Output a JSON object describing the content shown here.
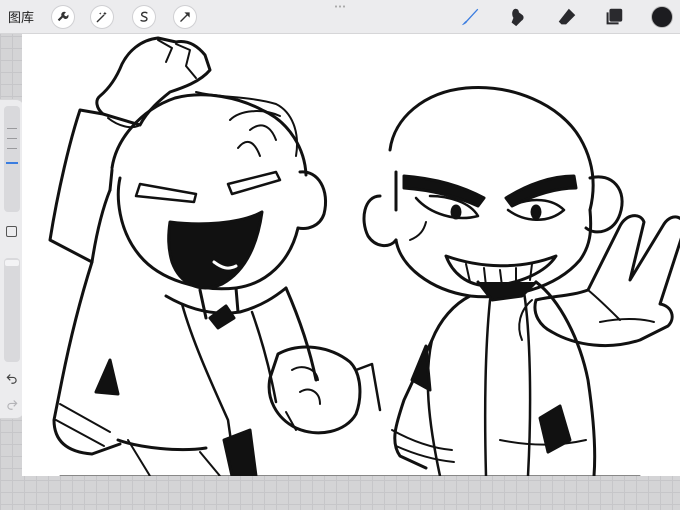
{
  "topbar": {
    "gallery_label": "图库",
    "left_tools": [
      {
        "icon": "wrench-icon"
      },
      {
        "icon": "magic-wand-icon"
      },
      {
        "icon": "selection-s-icon"
      },
      {
        "icon": "transform-arrow-icon"
      }
    ],
    "right_tools": [
      {
        "icon": "brush-icon",
        "active": true
      },
      {
        "icon": "smudge-icon",
        "active": false
      },
      {
        "icon": "eraser-icon",
        "active": false
      },
      {
        "icon": "layers-icon",
        "active": false
      }
    ],
    "active_color": "#1c1c20",
    "accent_color": "#3b7de0"
  },
  "sidebar": {
    "brush_size_level": 0.25,
    "opacity_level": 0.0
  },
  "canvas": {
    "background": "#ffffff",
    "content": "line-art-drawing"
  }
}
